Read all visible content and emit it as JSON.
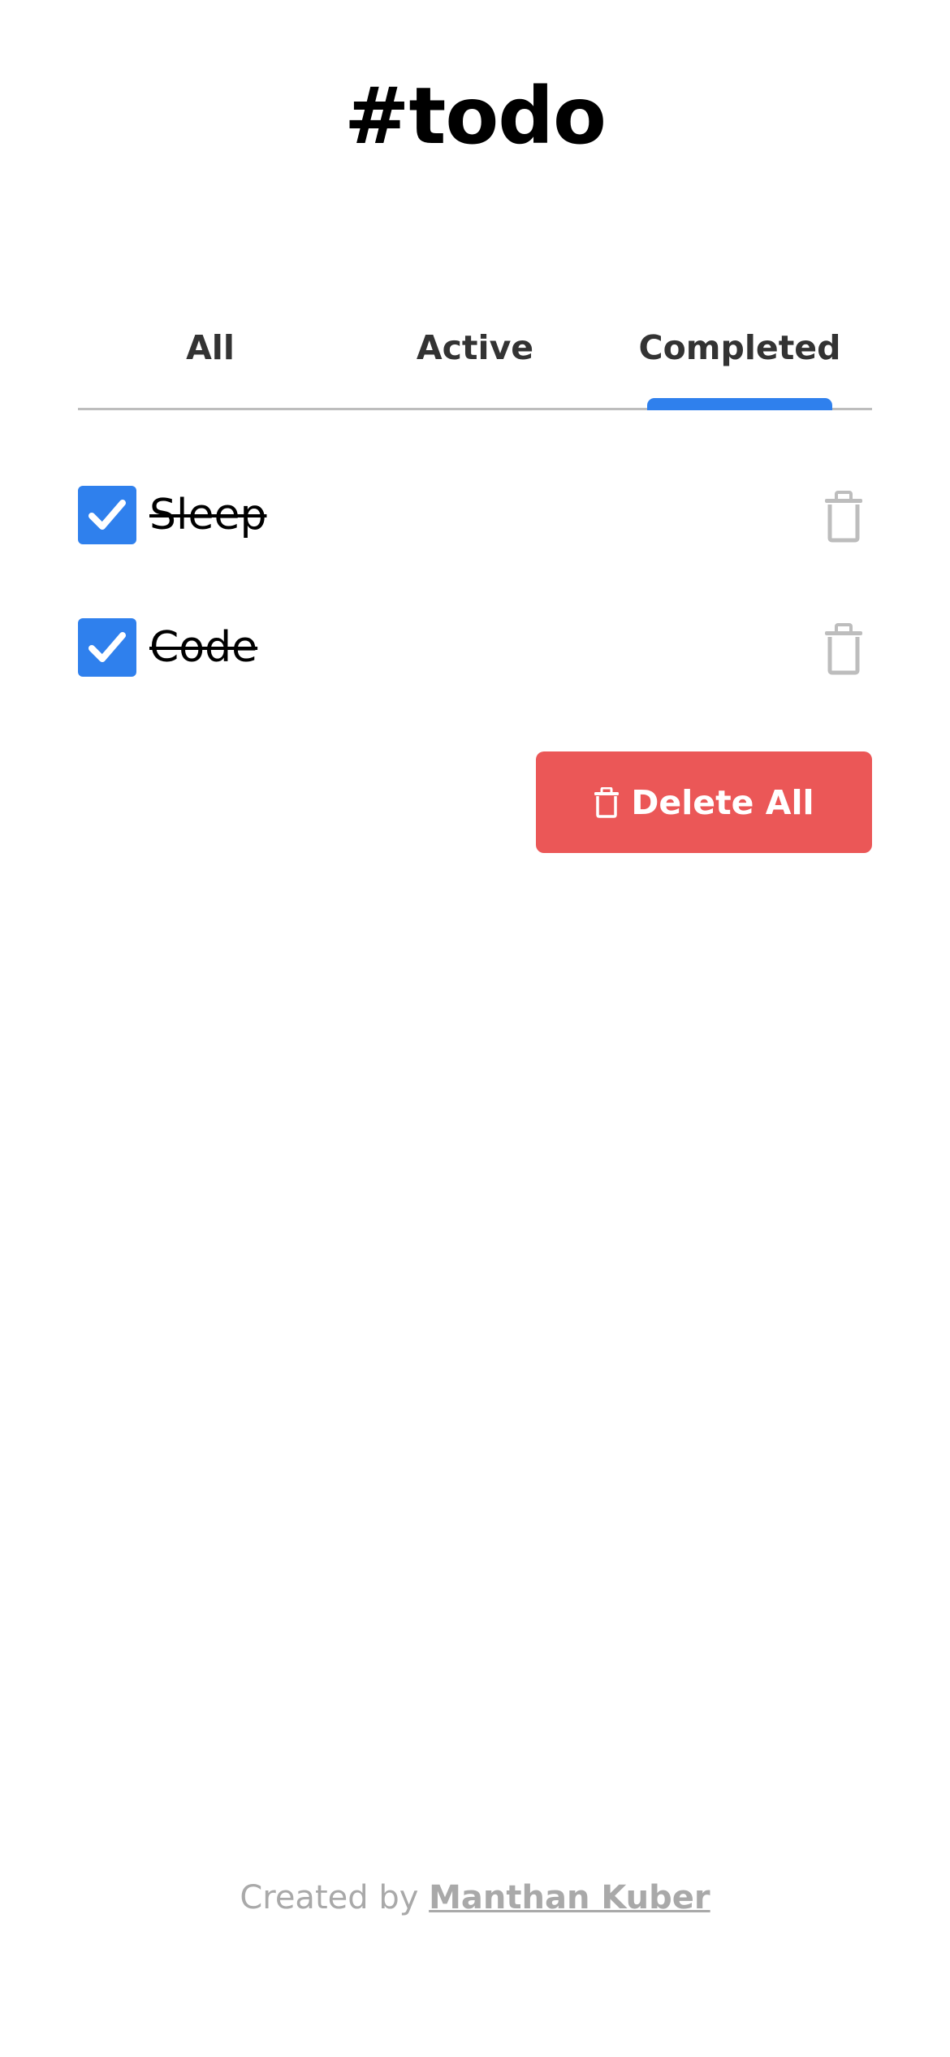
{
  "app": {
    "title": "#todo"
  },
  "tabs": [
    {
      "label": "All",
      "active": false
    },
    {
      "label": "Active",
      "active": false
    },
    {
      "label": "Completed",
      "active": true
    }
  ],
  "todos": [
    {
      "text": "Sleep",
      "completed": true,
      "delete_icon": "trash-icon"
    },
    {
      "text": "Code",
      "completed": true,
      "delete_icon": "trash-icon"
    }
  ],
  "actions": {
    "delete_all_label": "Delete All",
    "delete_all_icon": "trash-icon"
  },
  "footer": {
    "prefix": "Created by ",
    "author": "Manthan Kuber"
  },
  "colors": {
    "accent": "#2F80ED",
    "danger": "#EB5757",
    "muted": "#A9A9A9",
    "divider": "#BDBDBD"
  }
}
